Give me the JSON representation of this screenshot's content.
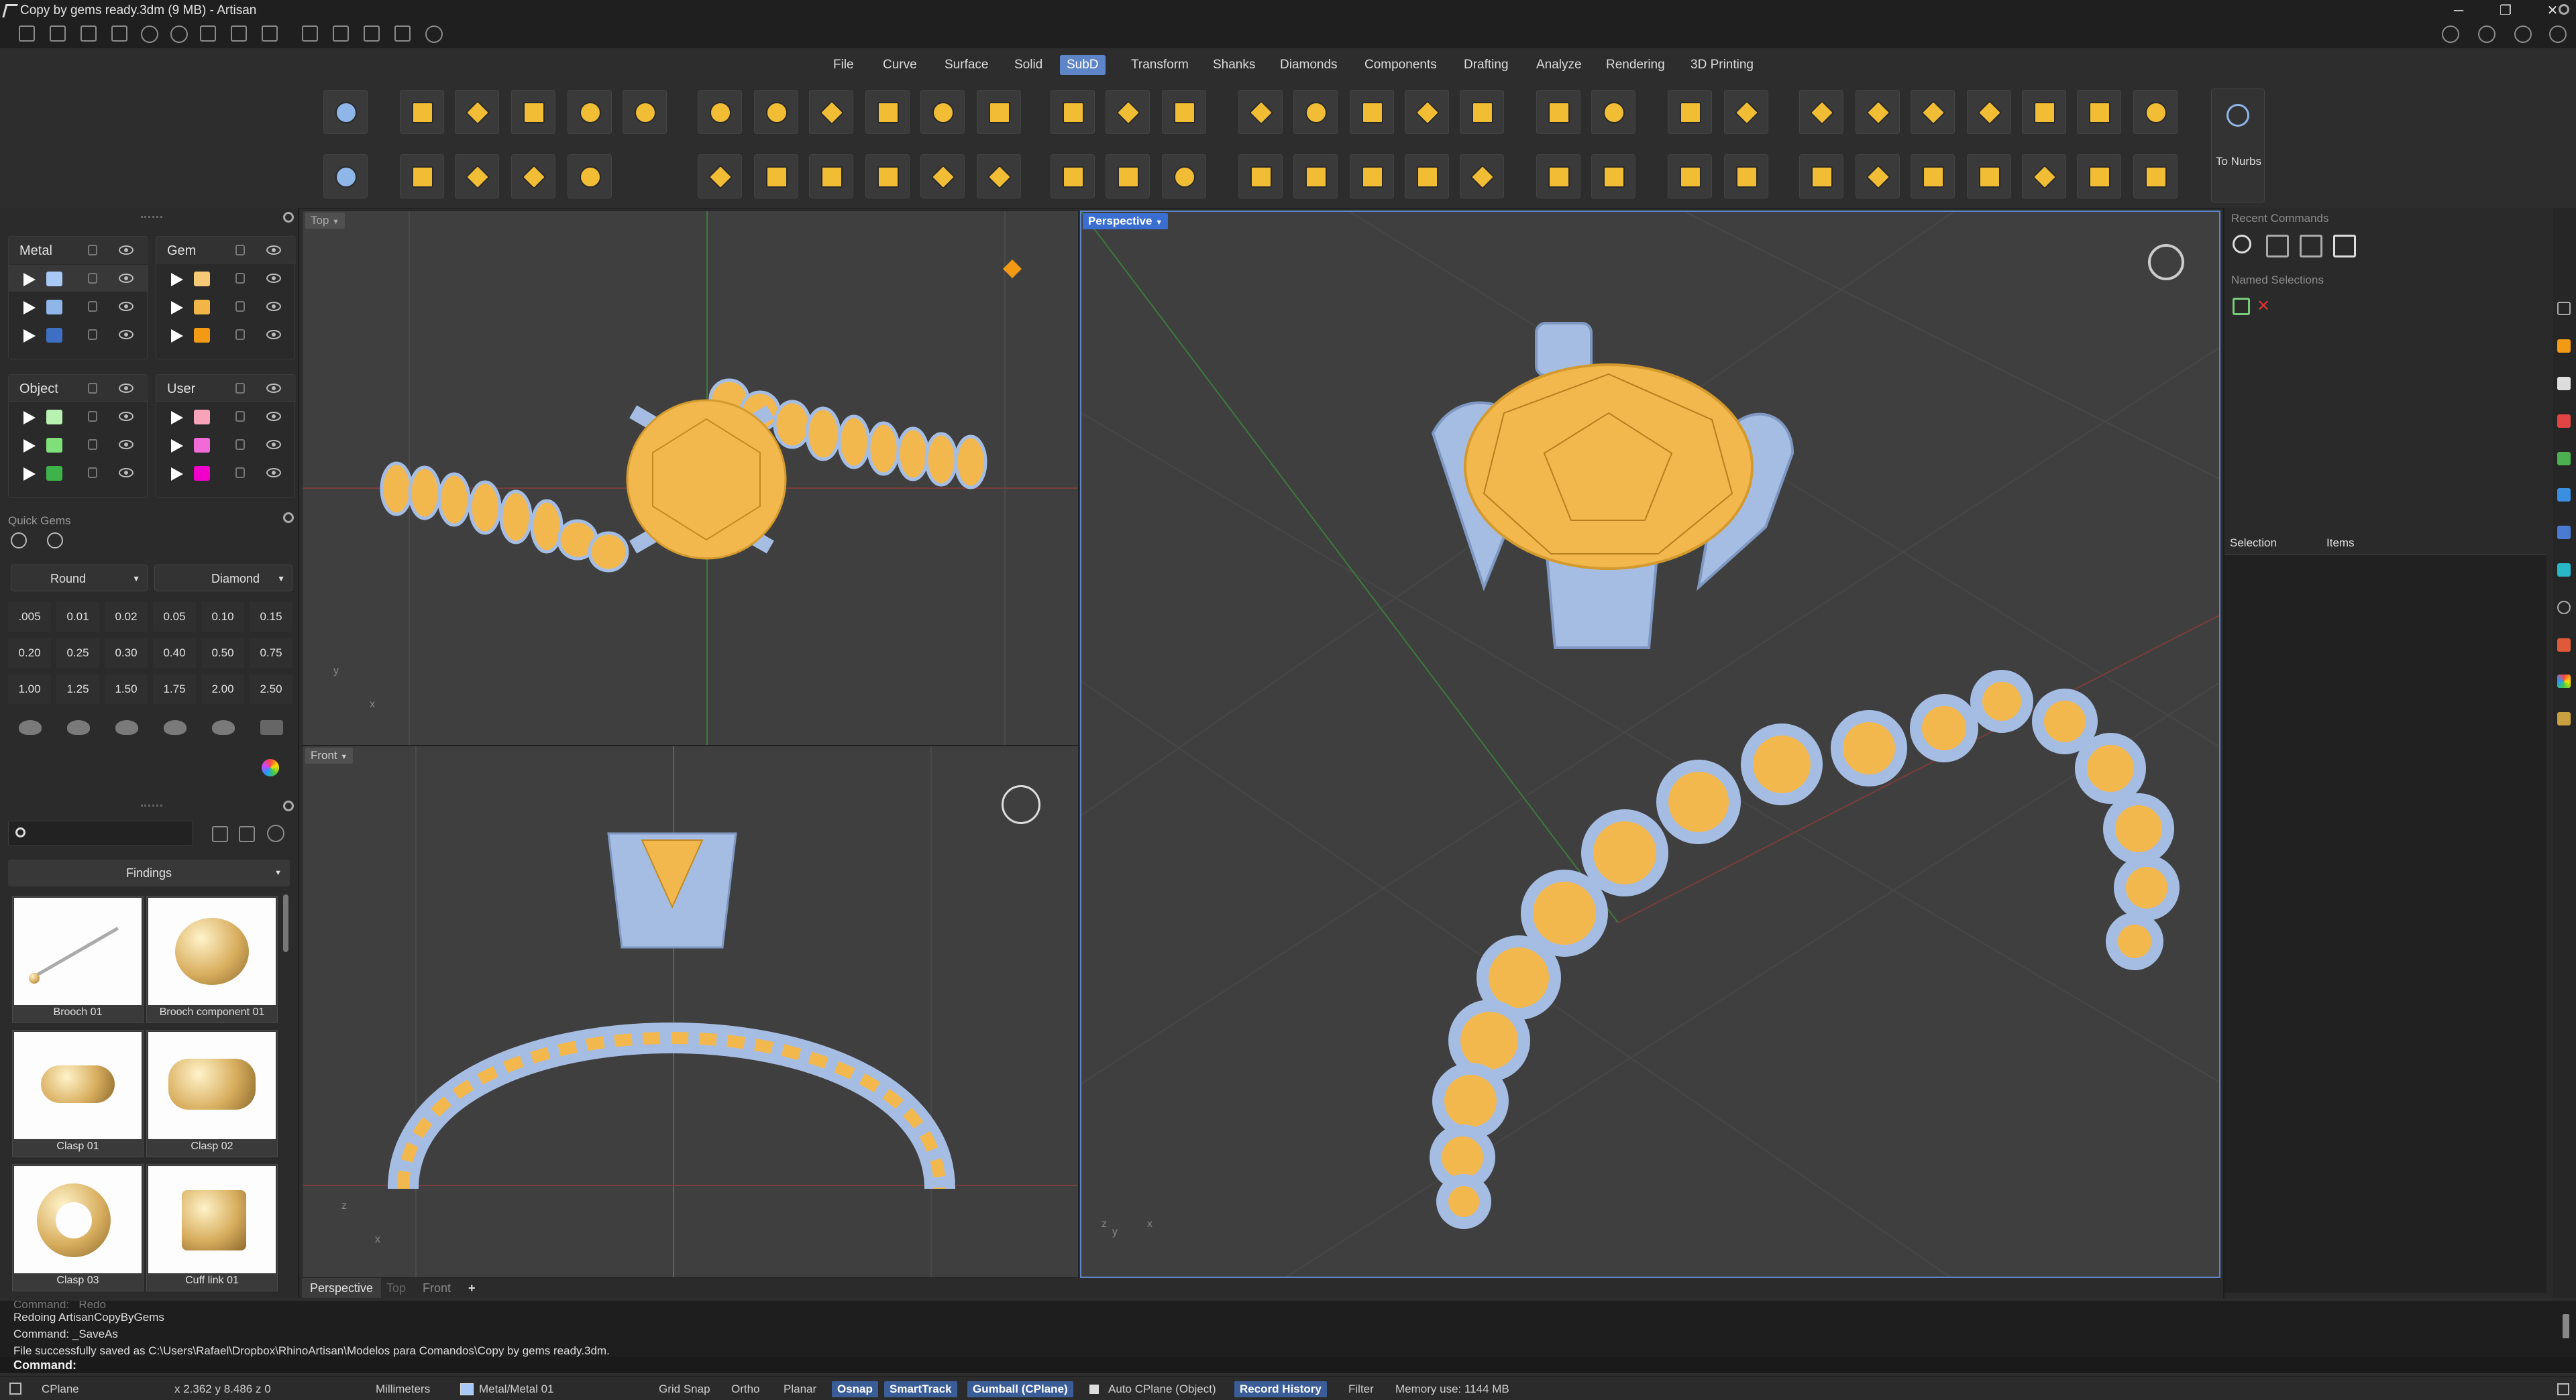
{
  "window": {
    "title": "Copy by gems ready.3dm (9 MB) - Artisan",
    "controls": [
      "─",
      "❐",
      "✕"
    ]
  },
  "menu": {
    "items": [
      "File",
      "Curve",
      "Surface",
      "Solid",
      "SubD",
      "Transform",
      "Shanks",
      "Diamonds",
      "Components",
      "Drafting",
      "Analyze",
      "Rendering",
      "3D Printing"
    ],
    "active": "SubD"
  },
  "ribbon": {
    "to_nurbs_label": "To Nurbs"
  },
  "layers": {
    "groups": [
      {
        "name": "Metal",
        "swatches": [
          "#a8c8f5",
          "#8fb6e8",
          "#3f6fc2"
        ]
      },
      {
        "name": "Gem",
        "swatches": [
          "#f6c976",
          "#f2b648",
          "#f29a14"
        ]
      },
      {
        "name": "Object",
        "swatches": [
          "#b8f2b0",
          "#7fe07a",
          "#3fb34a"
        ]
      },
      {
        "name": "User",
        "swatches": [
          "#f7a3b9",
          "#f06ad8",
          "#f000c8"
        ]
      }
    ]
  },
  "quick_gems": {
    "title": "Quick Gems",
    "shape": "Round",
    "material": "Diamond",
    "sizes": [
      ".005",
      "0.01",
      "0.02",
      "0.05",
      "0.10",
      "0.15",
      "0.20",
      "0.25",
      "0.30",
      "0.40",
      "0.50",
      "0.75",
      "1.00",
      "1.25",
      "1.50",
      "1.75",
      "2.00",
      "2.50"
    ]
  },
  "library": {
    "search_placeholder": "",
    "category": "Findings",
    "items": [
      {
        "caption": "Brooch 01"
      },
      {
        "caption": "Brooch component 01"
      },
      {
        "caption": "Clasp 01"
      },
      {
        "caption": "Clasp 02"
      },
      {
        "caption": "Clasp 03"
      },
      {
        "caption": "Cuff link 01"
      }
    ]
  },
  "viewports": {
    "top": {
      "label": "Top"
    },
    "front": {
      "label": "Front"
    },
    "perspective": {
      "label": "Perspective"
    },
    "axis": {
      "x": "x",
      "y": "y",
      "z": "z"
    }
  },
  "viewport_tabs": [
    "Perspective",
    "Top",
    "Front",
    "+"
  ],
  "right_panel": {
    "recent_commands_title": "Recent Commands",
    "named_selections_title": "Named Selections",
    "columns": [
      "Selection",
      "Items"
    ]
  },
  "command_history": [
    "Command: _Redo",
    "Redoing ArtisanCopyByGems",
    "Command: _SaveAs",
    "File successfully saved as C:\\Users\\Rafael\\Dropbox\\RhinoArtisan\\Modelos para Comandos\\Copy by gems ready.3dm."
  ],
  "command_prompt": "Command:",
  "status": {
    "cplane": "CPlane",
    "coords": "x 2.362   y 8.486   z 0",
    "units": "Millimeters",
    "layer": "Metal/Metal 01",
    "toggles": [
      {
        "label": "Grid Snap",
        "on": false
      },
      {
        "label": "Ortho",
        "on": false
      },
      {
        "label": "Planar",
        "on": false
      },
      {
        "label": "Osnap",
        "on": true
      },
      {
        "label": "SmartTrack",
        "on": true
      },
      {
        "label": "Gumball (CPlane)",
        "on": true
      }
    ],
    "auto_cplane": "Auto CPlane (Object)",
    "record_history": "Record History",
    "filter": "Filter",
    "memory": "Memory use: 1144 MB"
  },
  "colors": {
    "accent": "#5e85c8",
    "gem": "#f1bd35",
    "metal": "#a6bde3",
    "viewport_bg": "#3f3f3f"
  }
}
